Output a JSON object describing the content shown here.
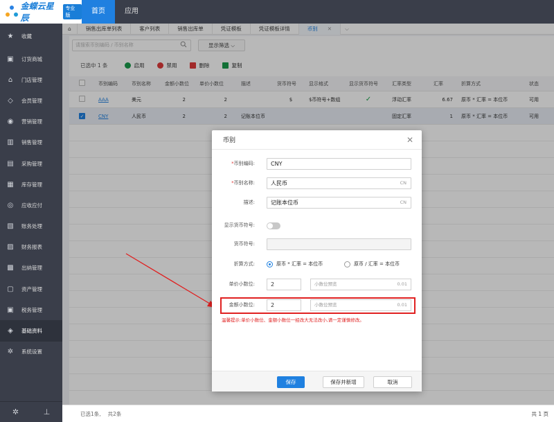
{
  "brand": {
    "name": "金蝶云星辰",
    "badge": "专业版"
  },
  "topnav": [
    {
      "label": "首页",
      "active": true
    },
    {
      "label": "应用",
      "active": false
    }
  ],
  "sidebar": {
    "items": [
      {
        "label": "收藏",
        "icon": "star-icon"
      },
      {
        "label": "订货商城",
        "icon": "cart-icon"
      },
      {
        "label": "门店管理",
        "icon": "store-icon"
      },
      {
        "label": "会员管理",
        "icon": "diamond-icon"
      },
      {
        "label": "营销管理",
        "icon": "target-icon"
      },
      {
        "label": "销售管理",
        "icon": "bar-icon"
      },
      {
        "label": "采购管理",
        "icon": "trolley-icon"
      },
      {
        "label": "库存管理",
        "icon": "box-icon"
      },
      {
        "label": "应收应付",
        "icon": "coin-icon"
      },
      {
        "label": "账务处理",
        "icon": "ledger-icon"
      },
      {
        "label": "财务报表",
        "icon": "report-icon"
      },
      {
        "label": "出纳管理",
        "icon": "cashier-icon"
      },
      {
        "label": "资产管理",
        "icon": "asset-icon"
      },
      {
        "label": "税务管理",
        "icon": "tax-icon"
      },
      {
        "label": "基础资料",
        "icon": "layers-icon"
      },
      {
        "label": "系统设置",
        "icon": "gear-icon"
      }
    ]
  },
  "tabs": [
    {
      "label": "销售出库单列表"
    },
    {
      "label": "客户列表"
    },
    {
      "label": "销售出库单"
    },
    {
      "label": "凭证模板"
    },
    {
      "label": "凭证模板详情"
    },
    {
      "label": "币别",
      "active": true
    }
  ],
  "filter": {
    "search_placeholder": "请搜索币别编码 / 币别名称",
    "filter_label": "显示筛选 ⌵"
  },
  "actions": {
    "selected_info": "已选中 1 条",
    "buttons": [
      {
        "label": "启用",
        "color": "#1a9b4c"
      },
      {
        "label": "禁用",
        "color": "#e03b3b"
      },
      {
        "label": "删除",
        "color": "#e03b3b"
      },
      {
        "label": "复制",
        "color": "#1a9b4c"
      }
    ]
  },
  "table": {
    "columns": [
      "币别编码",
      "币别名称",
      "金额小数位",
      "单价小数位",
      "描述",
      "货币符号",
      "显示格式",
      "显示货币符号",
      "汇率类型",
      "汇率",
      "折算方式",
      "状态"
    ],
    "rows": [
      {
        "code": "AAA",
        "name": "美元",
        "amt": "2",
        "price": "2",
        "desc": "",
        "symbol": "$",
        "format": "$币符号+数组",
        "show": "✓",
        "rate_type": "浮动汇率",
        "rate": "6.67",
        "method": "原币 * 汇率 = 本位币",
        "status": "可用",
        "checked": false
      },
      {
        "code": "CNY",
        "name": "人民币",
        "amt": "2",
        "price": "2",
        "desc": "记账本位币",
        "symbol": "",
        "format": "",
        "show": "",
        "rate_type": "固定汇率",
        "rate": "1",
        "method": "原币 * 汇率 = 本位币",
        "status": "可用",
        "checked": true
      }
    ]
  },
  "footer": {
    "selected": "已选1条,",
    "total": "共2条",
    "pages": "共 1 页"
  },
  "modal": {
    "title": "币别",
    "code_label": "币别编码:",
    "code_value": "CNY",
    "name_label": "币别名称:",
    "name_value": "人民币",
    "name_suffix": "CN",
    "desc_label": "描述:",
    "desc_value": "记账本位币",
    "desc_suffix": "CN",
    "show_symbol_label": "显示货币符号:",
    "symbol_label": "货币符号:",
    "method_label": "折算方式:",
    "method_opt1": "原币 * 汇率 = 本位币",
    "method_opt2": "原币 / 汇率 = 本位币",
    "price_dec_label": "单价小数位:",
    "price_dec_value": "2",
    "price_preview_placeholder": "小数位预览",
    "price_preview_value": "0.01",
    "amt_dec_label": "金额小数位:",
    "amt_dec_value": "2",
    "amt_preview_placeholder": "小数位预览",
    "amt_preview_value": "0.01",
    "hint": "温馨提示:单价小数位、金额小数位一经改大无法改小,请一定谨慎修改。",
    "save": "保存",
    "save_new": "保存并新增",
    "cancel": "取消"
  },
  "colors": {
    "accent": "#1f80e0",
    "sidebar": "#3a3e4a",
    "danger": "#e02020"
  }
}
